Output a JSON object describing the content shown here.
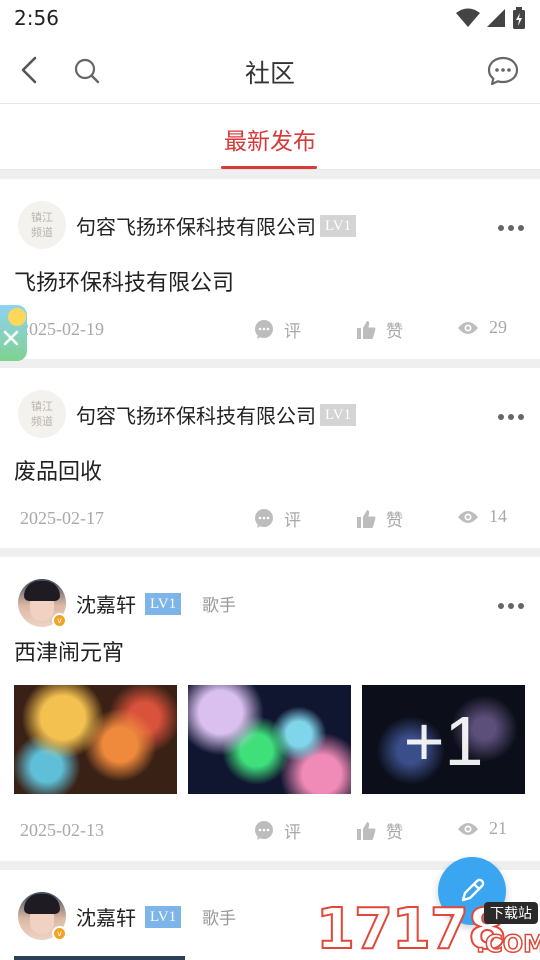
{
  "status_bar": {
    "time": "2:56"
  },
  "nav": {
    "title": "社区"
  },
  "tabs": {
    "active": "最新发布"
  },
  "company_logo": {
    "line1": "镇江",
    "line2": "频道"
  },
  "posts": [
    {
      "author": "句容飞扬环保科技有限公司",
      "level": "LV1",
      "title": "飞扬环保科技有限公司",
      "date": "2025-02-19",
      "comment_label": "评",
      "like_label": "赞",
      "views": "29"
    },
    {
      "author": "句容飞扬环保科技有限公司",
      "level": "LV1",
      "title": "废品回收",
      "date": "2025-02-17",
      "comment_label": "评",
      "like_label": "赞",
      "views": "14"
    },
    {
      "author": "沈嘉轩",
      "level": "LV1",
      "role": "歌手",
      "title": "西津闹元宵",
      "more_images": "+1",
      "date": "2025-02-13",
      "comment_label": "评",
      "like_label": "赞",
      "views": "21"
    },
    {
      "author": "沈嘉轩",
      "level": "LV1",
      "role": "歌手"
    }
  ],
  "verified_badge": "v",
  "watermark": {
    "number": "17178",
    "domain": ".COM",
    "tag": "下载站"
  },
  "colors": {
    "accent": "#d83a3a",
    "level_blue": "#7db5e9",
    "fab": "#3aa6f2",
    "muted": "#a8a8a8"
  }
}
